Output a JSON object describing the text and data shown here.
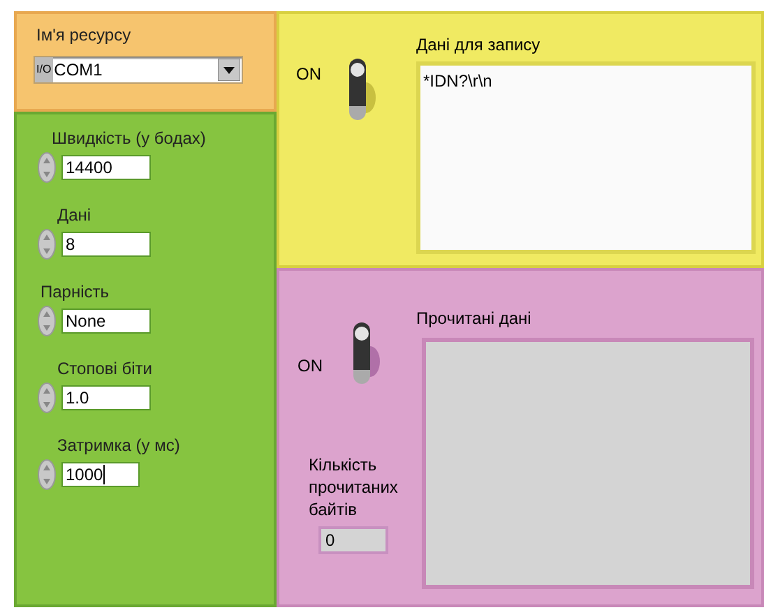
{
  "resource": {
    "label": "Ім'я ресурсу",
    "prefix": "I/O",
    "value": "COM1"
  },
  "settings": [
    {
      "label": "Швидкість (у бодах)",
      "value": "14400",
      "focused": false
    },
    {
      "label": "Дані",
      "value": "8",
      "focused": false
    },
    {
      "label": "Парність",
      "value": "None",
      "focused": false
    },
    {
      "label": "Стопові біти",
      "value": "1.0",
      "focused": false
    },
    {
      "label": "Затримка (у мс)",
      "value": "1000",
      "focused": true
    }
  ],
  "write": {
    "switch_label": "ON",
    "on": true,
    "label": "Дані для запису",
    "value": "*IDN?\\r\\n"
  },
  "read": {
    "switch_label": "ON",
    "on": true,
    "label": "Прочитані дані",
    "count_label": "Кількість прочитаних байтів",
    "count": "0"
  }
}
